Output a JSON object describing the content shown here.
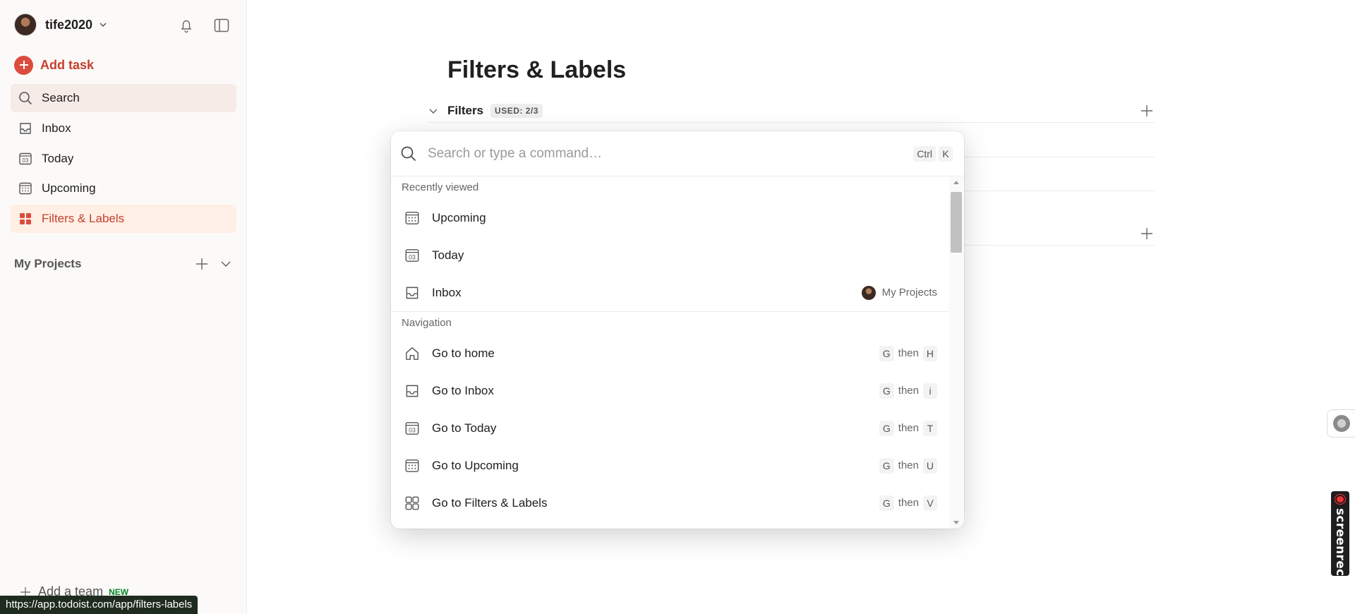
{
  "sidebar": {
    "username": "tife2020",
    "add_task": "Add task",
    "nav": [
      {
        "label": "Search"
      },
      {
        "label": "Inbox"
      },
      {
        "label": "Today",
        "icon_text": "03"
      },
      {
        "label": "Upcoming"
      },
      {
        "label": "Filters & Labels"
      }
    ],
    "projects_label": "My Projects",
    "add_team": "Add a team",
    "new_badge": "NEW"
  },
  "status_url": "https://app.todoist.com/app/filters-labels",
  "main": {
    "title": "Filters & Labels",
    "filters_section": {
      "title": "Filters",
      "used_badge": "USED: 2/3"
    }
  },
  "palette": {
    "placeholder": "Search or type a command…",
    "shortcut": [
      "Ctrl",
      "K"
    ],
    "recent_header": "Recently viewed",
    "recent": [
      {
        "label": "Upcoming",
        "icon": "upcoming-icon"
      },
      {
        "label": "Today",
        "icon": "today-icon",
        "icon_text": "03"
      },
      {
        "label": "Inbox",
        "icon": "inbox-icon",
        "meta": "My Projects"
      }
    ],
    "nav_header": "Navigation",
    "navigation": [
      {
        "label": "Go to home",
        "icon": "home-icon",
        "keys": [
          "G",
          "then",
          "H"
        ]
      },
      {
        "label": "Go to Inbox",
        "icon": "inbox-icon",
        "keys": [
          "G",
          "then",
          "i"
        ]
      },
      {
        "label": "Go to Today",
        "icon": "today-icon",
        "keys": [
          "G",
          "then",
          "T"
        ]
      },
      {
        "label": "Go to Upcoming",
        "icon": "upcoming-icon",
        "keys": [
          "G",
          "then",
          "U"
        ]
      },
      {
        "label": "Go to Filters & Labels",
        "icon": "filters-icon",
        "keys": [
          "G",
          "then",
          "V"
        ]
      }
    ]
  },
  "overlay": {
    "screenrec": "screenrec"
  },
  "colors": {
    "accent": "#dc4c3e",
    "accent_text": "#c4402f",
    "active_bg": "#ffefe5",
    "search_bg": "#f7ebe7"
  }
}
